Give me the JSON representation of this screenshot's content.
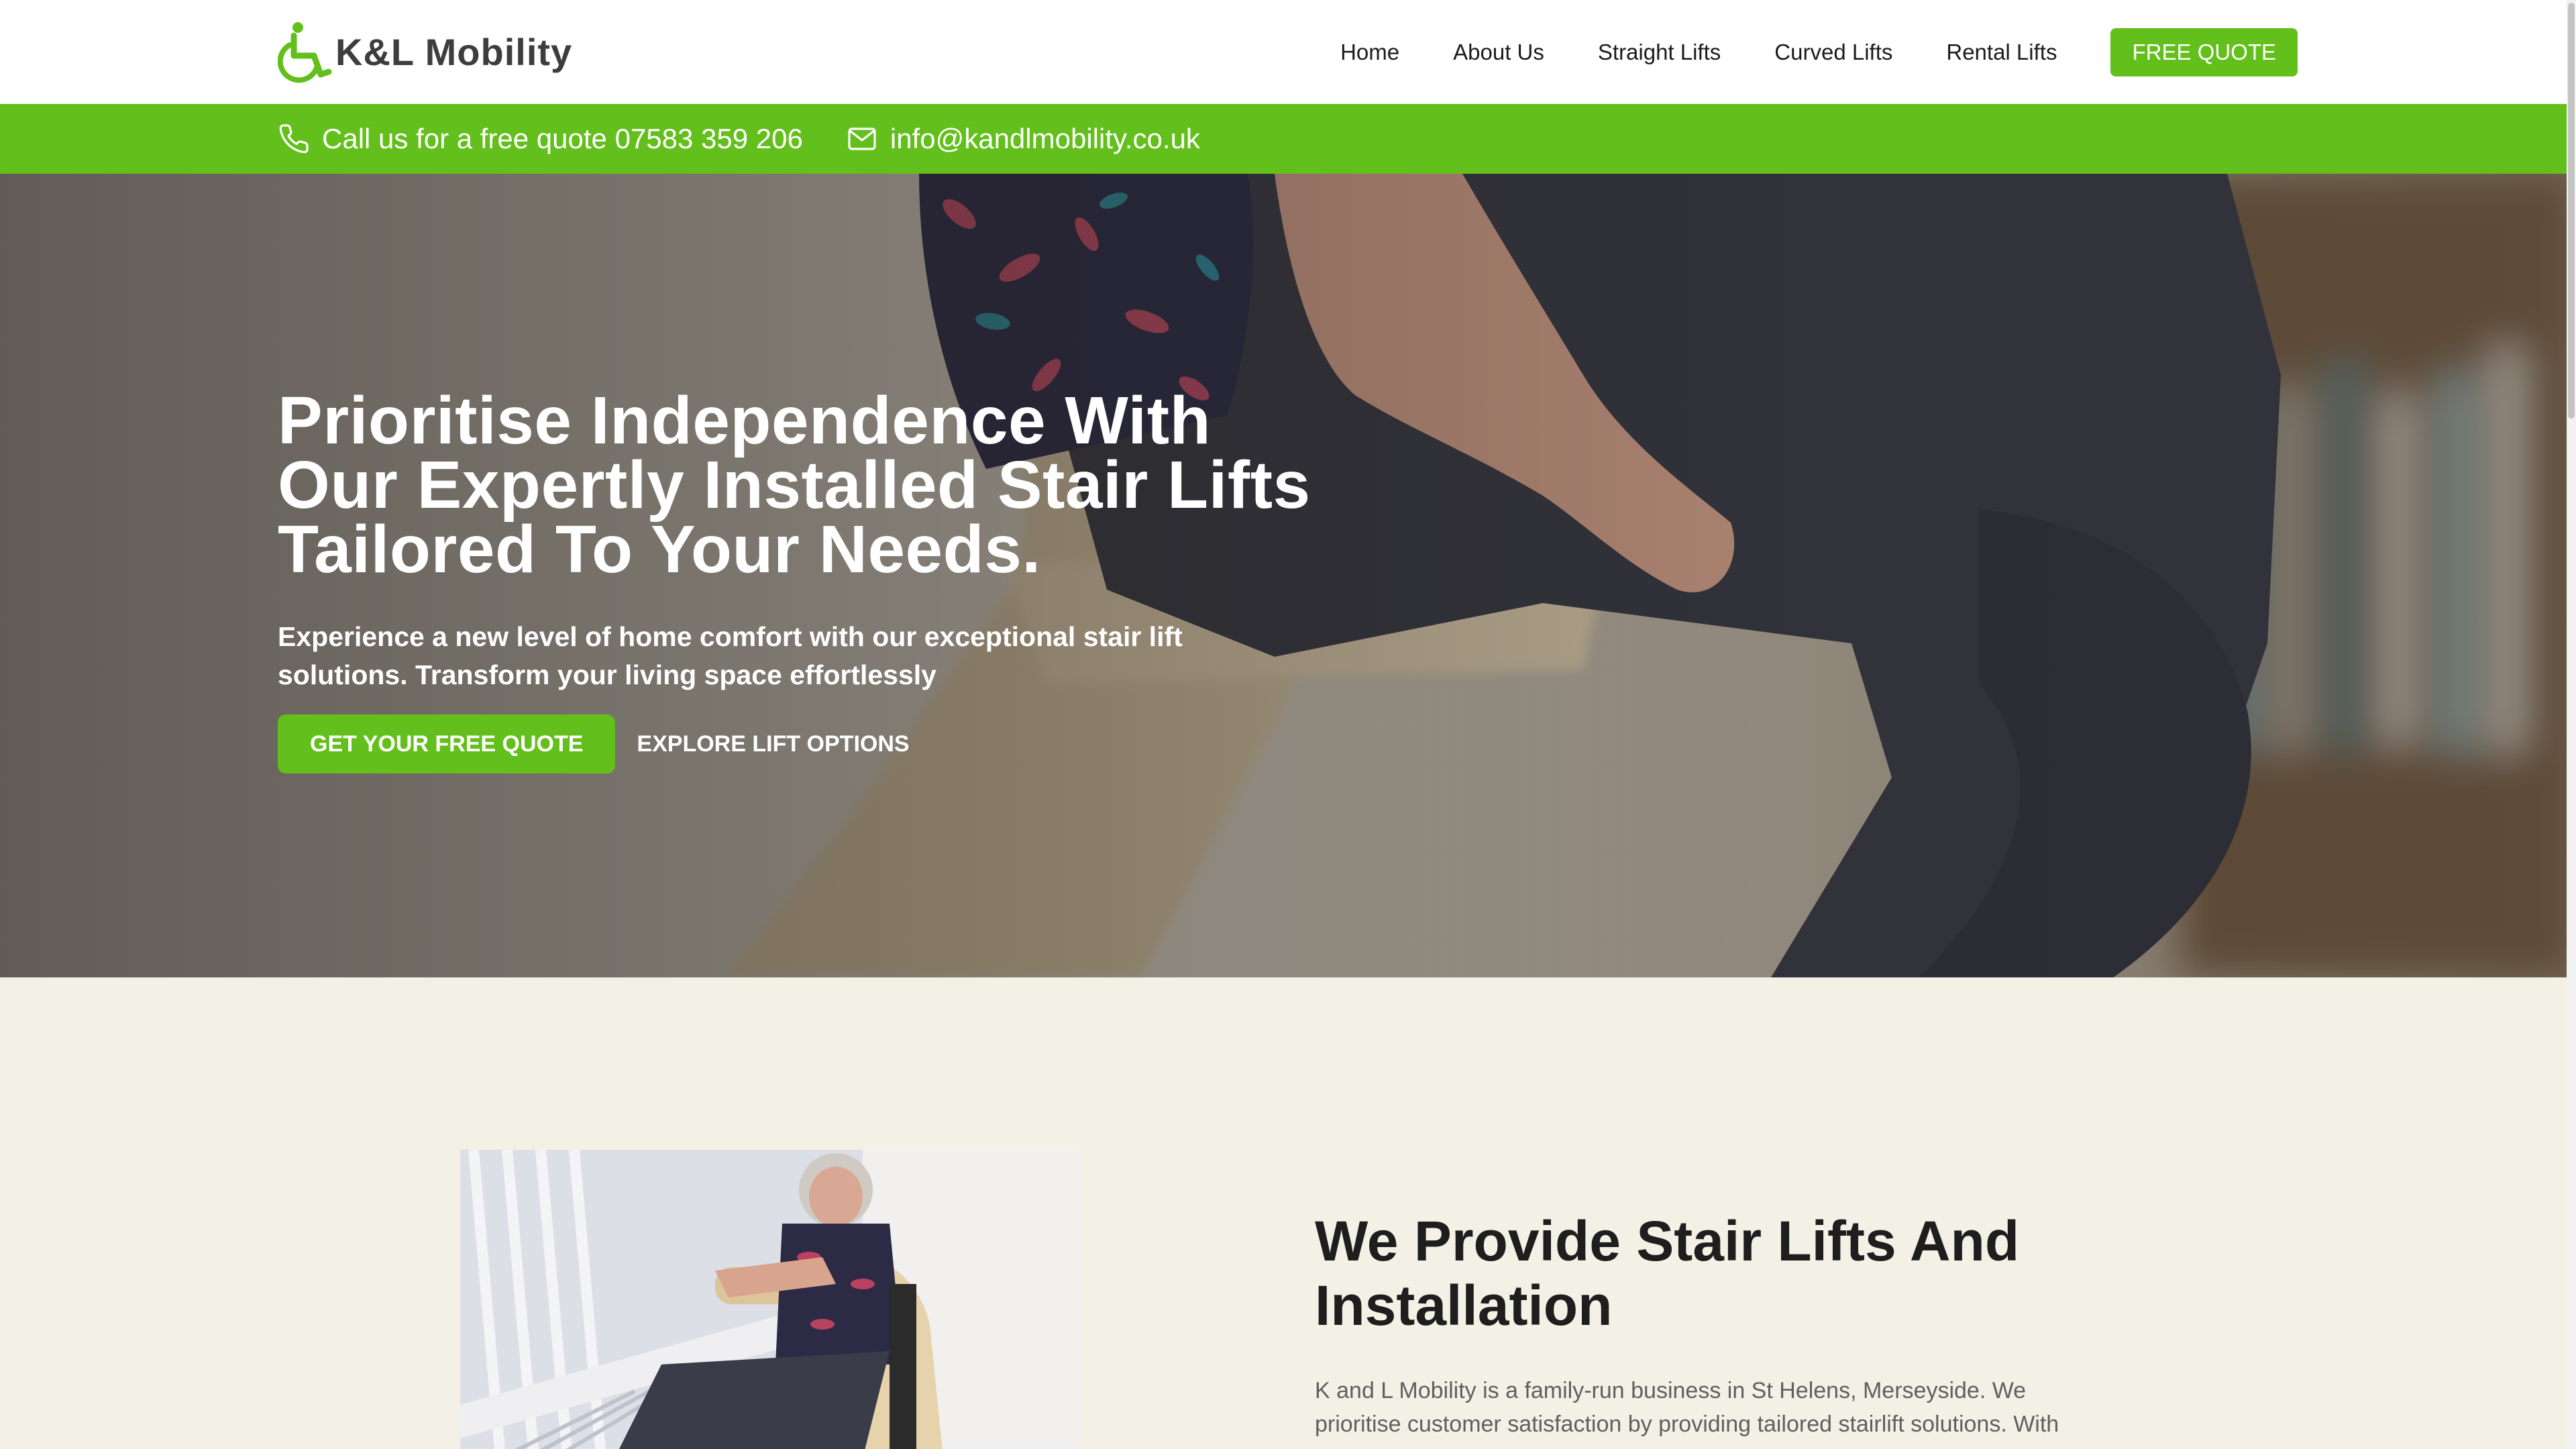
{
  "brand": {
    "name": "K&L Mobility",
    "accent": "#63bf1b",
    "logo_icon": "wheelchair-icon"
  },
  "nav": {
    "items": [
      {
        "label": "Home"
      },
      {
        "label": "About Us"
      },
      {
        "label": "Straight Lifts"
      },
      {
        "label": "Curved Lifts"
      },
      {
        "label": "Rental Lifts"
      }
    ],
    "cta_label": "FREE QUOTE"
  },
  "contact": {
    "phone_icon": "phone-icon",
    "phone_text": "Call us for a free quote 07583 359 206",
    "email_icon": "mail-icon",
    "email_text": "info@kandlmobility.co.uk"
  },
  "hero": {
    "title": "Prioritise Independence With Our Expertly Installed Stair Lifts Tailored To Your Needs.",
    "subtitle": "Experience a new level of home comfort with our exceptional stair lift solutions. Transform your living space effortlessly",
    "primary_button": "GET YOUR FREE QUOTE",
    "secondary_button": "EXPLORE LIFT OPTIONS"
  },
  "about": {
    "title": "We Provide Stair Lifts And Installation",
    "body": "K and L Mobility is a family-run business in St Helens, Merseyside. We prioritise customer satisfaction by providing tailored stairlift solutions. With"
  }
}
